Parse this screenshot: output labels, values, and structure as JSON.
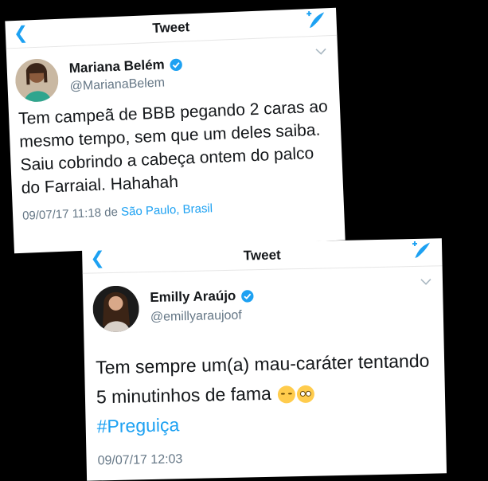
{
  "tweet1": {
    "nav_title": "Tweet",
    "author_name": "Mariana Belém",
    "author_handle": "@MarianaBelem",
    "text": "Tem campeã de BBB pegando 2 caras ao mesmo tempo, sem que um deles saiba. Saiu cobrindo a cabeça ontem do palco do Farraial. Hahahah",
    "timestamp": "09/07/17 11:18",
    "from_word": "de",
    "location": "São Paulo, Brasil"
  },
  "tweet2": {
    "nav_title": "Tweet",
    "author_name": "Emilly Araújo",
    "author_handle": "@emillyaraujoof",
    "text": "Tem sempre um(a) mau-caráter tentando 5 minutinhos de fama",
    "hashtag": "#Preguiça",
    "timestamp": "09/07/17 12:03"
  },
  "icons": {
    "back": "chevron-left-icon",
    "compose": "compose-tweet-icon",
    "verified": "verified-badge-icon",
    "more": "chevron-down-icon",
    "emojis": [
      "sleepy-face-emoji",
      "rolling-eyes-emoji"
    ]
  },
  "colors": {
    "accent": "#1da1f2",
    "text": "#14171a",
    "muted": "#657786",
    "background": "#000000"
  }
}
